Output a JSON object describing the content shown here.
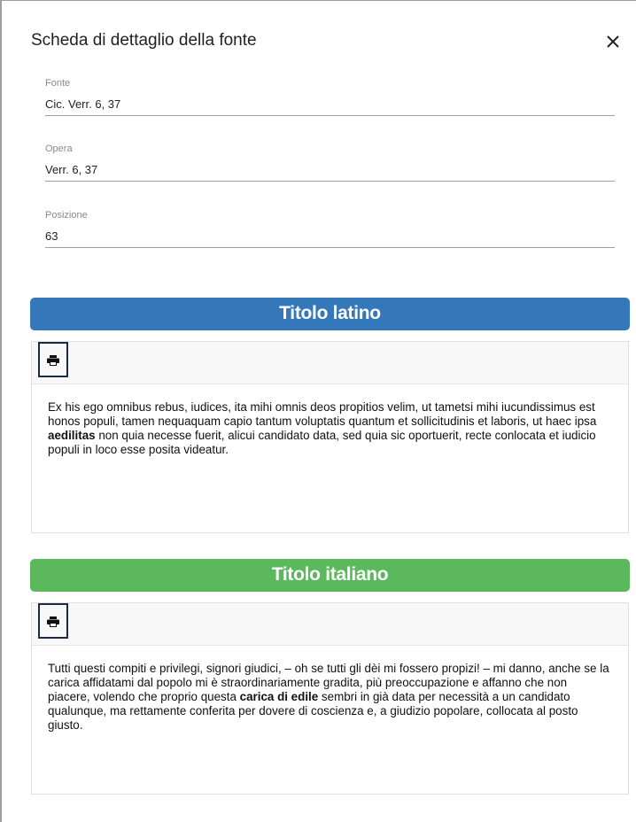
{
  "dialog": {
    "title": "Scheda di dettaglio della fonte",
    "close_icon": "close-icon"
  },
  "fields": {
    "fonte": {
      "label": "Fonte",
      "value": "Cic. Verr. 6, 37"
    },
    "opera": {
      "label": "Opera",
      "value": "Verr. 6, 37"
    },
    "posizione": {
      "label": "Posizione",
      "value": "63"
    }
  },
  "latin": {
    "title": "Titolo latino",
    "color": "#3478b9",
    "print_icon": "print-icon",
    "text_before": "Ex his ego omnibus rebus, iudices, ita mihi omnis deos propitios velim, ut tametsi mihi iucundissimus est honos populi, tamen nequaquam capio tantum voluptatis quantum et sollicitudinis et laboris, ut haec ipsa ",
    "text_bold": "aedilitas",
    "text_after": " non quia necesse fuerit, alicui candidato data, sed quia sic oportuerit, recte conlocata et iudicio populi in loco esse posita videatur."
  },
  "italian": {
    "title": "Titolo italiano",
    "color": "#5cb85c",
    "print_icon": "print-icon",
    "text_before": "Tutti questi compiti e privilegi, signori giudici, – oh se tutti gli dèi mi fossero propizi! – mi danno, anche se la carica affidatami dal popolo mi è straordinariamente gradita, più preoccupazione e affanno che non piacere, volendo che proprio questa ",
    "text_bold": "carica di edile",
    "text_after": " sembri in già data per necessità a un candidato qualunque, ma rettamente conferita per dovere di coscienza e, a giudizio popolare, collocata al posto giusto."
  }
}
